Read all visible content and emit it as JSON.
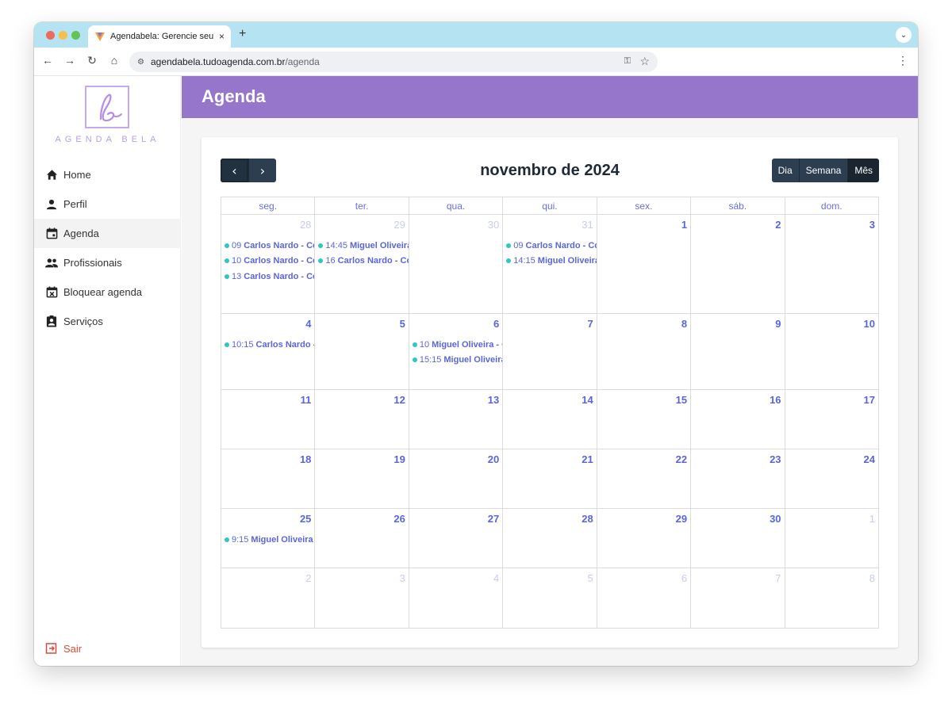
{
  "browser": {
    "tab_title": "Agendabela: Gerencie seu salão",
    "tab_close": "×",
    "new_tab": "+",
    "url_host": "agendabela.tudoagenda.com.br",
    "url_path": "/agenda",
    "icons": [
      "back-icon",
      "forward-icon",
      "reload-icon",
      "home-icon",
      "key-icon",
      "star-icon",
      "menu-icon"
    ]
  },
  "sidebar": {
    "logo_text": "AGENDA BELA",
    "items": [
      {
        "label": "Home",
        "icon": "home-icon",
        "active": false
      },
      {
        "label": "Perfil",
        "icon": "person-icon",
        "active": false
      },
      {
        "label": "Agenda",
        "icon": "calendar-icon",
        "active": true
      },
      {
        "label": "Profissionais",
        "icon": "group-icon",
        "active": false
      },
      {
        "label": "Bloquear agenda",
        "icon": "calendar-block-icon",
        "active": false
      },
      {
        "label": "Serviços",
        "icon": "badge-icon",
        "active": false
      }
    ],
    "logout_label": "Sair"
  },
  "header": {
    "title": "Agenda"
  },
  "calendar": {
    "title": "novembro de 2024",
    "prev_label": "‹",
    "next_label": "›",
    "views": [
      "Dia",
      "Semana",
      "Mês"
    ],
    "active_view": "Mês",
    "dow": [
      "seg.",
      "ter.",
      "qua.",
      "qui.",
      "sex.",
      "sáb.",
      "dom."
    ],
    "weeks": [
      [
        {
          "n": "28",
          "other": true,
          "events": [
            {
              "time": "09",
              "title": "Carlos Nardo - Corte"
            },
            {
              "time": "10",
              "title": "Carlos Nardo - Corte"
            },
            {
              "time": "13",
              "title": "Carlos Nardo - Corte"
            }
          ]
        },
        {
          "n": "29",
          "other": true,
          "events": [
            {
              "time": "14:45",
              "title": "Miguel Oliveira"
            },
            {
              "time": "16",
              "title": "Carlos Nardo - Corte"
            }
          ]
        },
        {
          "n": "30",
          "other": true,
          "events": []
        },
        {
          "n": "31",
          "other": true,
          "events": [
            {
              "time": "09",
              "title": "Carlos Nardo - Corte"
            },
            {
              "time": "14:15",
              "title": "Miguel Oliveira"
            }
          ]
        },
        {
          "n": "1",
          "other": false,
          "events": []
        },
        {
          "n": "2",
          "other": false,
          "events": []
        },
        {
          "n": "3",
          "other": false,
          "events": []
        }
      ],
      [
        {
          "n": "4",
          "other": false,
          "events": [
            {
              "time": "10:15",
              "title": "Carlos Nardo - Corte"
            }
          ]
        },
        {
          "n": "5",
          "other": false,
          "events": []
        },
        {
          "n": "6",
          "other": false,
          "events": [
            {
              "time": "10",
              "title": "Miguel Oliveira - Corte"
            },
            {
              "time": "15:15",
              "title": "Miguel Oliveira"
            }
          ]
        },
        {
          "n": "7",
          "other": false,
          "events": []
        },
        {
          "n": "8",
          "other": false,
          "events": []
        },
        {
          "n": "9",
          "other": false,
          "events": []
        },
        {
          "n": "10",
          "other": false,
          "events": []
        }
      ],
      [
        {
          "n": "11",
          "other": false,
          "events": []
        },
        {
          "n": "12",
          "other": false,
          "events": []
        },
        {
          "n": "13",
          "other": false,
          "events": []
        },
        {
          "n": "14",
          "other": false,
          "events": []
        },
        {
          "n": "15",
          "other": false,
          "events": []
        },
        {
          "n": "16",
          "other": false,
          "events": []
        },
        {
          "n": "17",
          "other": false,
          "events": []
        }
      ],
      [
        {
          "n": "18",
          "other": false,
          "events": []
        },
        {
          "n": "19",
          "other": false,
          "events": []
        },
        {
          "n": "20",
          "other": false,
          "events": []
        },
        {
          "n": "21",
          "other": false,
          "events": []
        },
        {
          "n": "22",
          "other": false,
          "events": []
        },
        {
          "n": "23",
          "other": false,
          "events": []
        },
        {
          "n": "24",
          "other": false,
          "events": []
        }
      ],
      [
        {
          "n": "25",
          "other": false,
          "events": [
            {
              "time": "9:15",
              "title": "Miguel Oliveira"
            }
          ]
        },
        {
          "n": "26",
          "other": false,
          "events": []
        },
        {
          "n": "27",
          "other": false,
          "events": []
        },
        {
          "n": "28",
          "other": false,
          "events": []
        },
        {
          "n": "29",
          "other": false,
          "events": []
        },
        {
          "n": "30",
          "other": false,
          "events": []
        },
        {
          "n": "1",
          "other": true,
          "events": []
        }
      ],
      [
        {
          "n": "2",
          "other": true,
          "events": []
        },
        {
          "n": "3",
          "other": true,
          "events": []
        },
        {
          "n": "4",
          "other": true,
          "events": []
        },
        {
          "n": "5",
          "other": true,
          "events": []
        },
        {
          "n": "6",
          "other": true,
          "events": []
        },
        {
          "n": "7",
          "other": true,
          "events": []
        },
        {
          "n": "8",
          "other": true,
          "events": []
        }
      ]
    ]
  },
  "colors": {
    "header": "#9576cb",
    "tabbar": "#b5e3f2",
    "accent": "#5a66d6",
    "event_dot": "#2cc9c0",
    "button": "#2c3e50",
    "logout": "#d94b3b"
  }
}
